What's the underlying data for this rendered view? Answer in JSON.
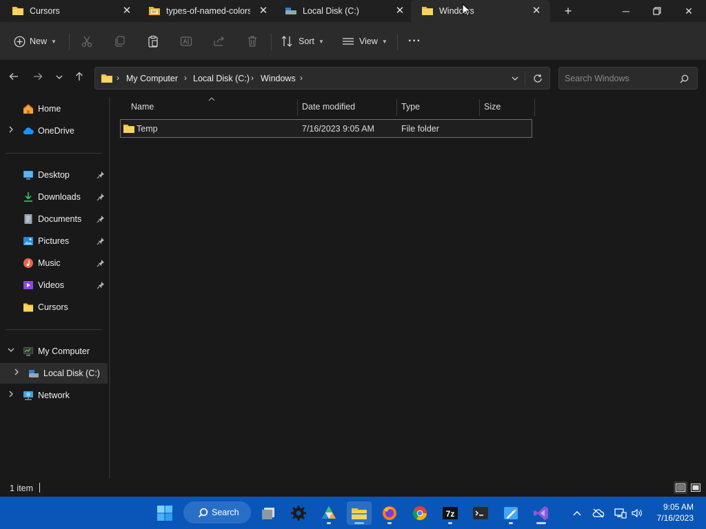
{
  "tabs": [
    {
      "title": "Cursors",
      "icon": "folder-icon"
    },
    {
      "title": "types-of-named-colors",
      "icon": "html-file-icon"
    },
    {
      "title": "Local Disk (C:)",
      "icon": "drive-icon"
    },
    {
      "title": "Windows",
      "icon": "folder-icon",
      "active": true
    }
  ],
  "toolbar": {
    "new_label": "New",
    "sort_label": "Sort",
    "view_label": "View",
    "more_label": "···"
  },
  "address": {
    "crumbs": [
      "My Computer",
      "Local Disk (C:)",
      "Windows"
    ]
  },
  "search": {
    "placeholder": "Search Windows"
  },
  "nav": {
    "quick": [
      {
        "label": "Home"
      },
      {
        "label": "OneDrive"
      }
    ],
    "pinned": [
      {
        "label": "Desktop"
      },
      {
        "label": "Downloads"
      },
      {
        "label": "Documents"
      },
      {
        "label": "Pictures"
      },
      {
        "label": "Music"
      },
      {
        "label": "Videos"
      },
      {
        "label": "Cursors"
      }
    ],
    "tree": [
      {
        "label": "My Computer"
      },
      {
        "label": "Local Disk (C:)"
      },
      {
        "label": "Network"
      }
    ]
  },
  "columns": [
    "Name",
    "Date modified",
    "Type",
    "Size"
  ],
  "files": [
    {
      "name": "Temp",
      "date": "7/16/2023 9:05 AM",
      "type": "File folder",
      "size": ""
    }
  ],
  "status": {
    "count": "1 item"
  },
  "taskbar": {
    "search_label": "Search",
    "time": "9:05 AM",
    "date": "7/16/2023"
  },
  "colors": {
    "accent": "#0a56b8",
    "folder": "#f4c542",
    "window_bg": "#191919"
  }
}
